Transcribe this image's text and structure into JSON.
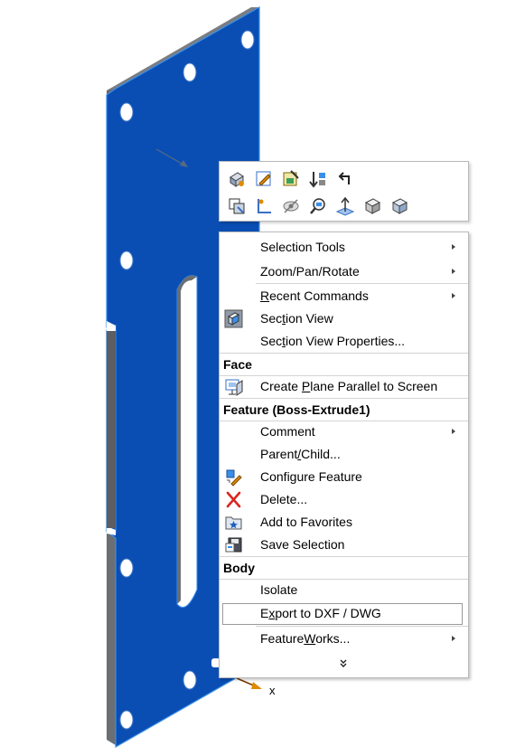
{
  "model": {
    "description_colors": {
      "face": "#0a4eb4",
      "edge": "#6f7277",
      "highlight": "#3a8fe8"
    }
  },
  "axis": {
    "x_label": "x"
  },
  "minitoolbar": {
    "row1_icons": [
      "appearance-icon",
      "edit-sketch-icon",
      "edit-feature-icon",
      "reorder-icon",
      "parent-child-back-icon"
    ],
    "row2_icons": [
      "hide-show-icon",
      "sketch-icon",
      "hide-icon",
      "zoom-to-selection-icon",
      "normal-to-icon",
      "view-orientation-icon",
      "display-style-icon"
    ]
  },
  "menu": {
    "selection_tools": "Selection Tools",
    "zoom_pan_rotate": "Zoom/Pan/Rotate",
    "recent_pre": "",
    "recent_ul": "R",
    "recent_post": "ecent Commands",
    "section_pre": "Sec",
    "section_ul": "t",
    "section_post": "ion View",
    "section_props_pre": "Sec",
    "section_props_ul": "t",
    "section_props_post": "ion View Properties...",
    "face_header": "Face",
    "create_plane_pre": "Create ",
    "create_plane_ul": "P",
    "create_plane_post": "lane Parallel to Screen",
    "feature_header": "Feature (Boss-Extrude1)",
    "comment": "Comment",
    "parent_pre": "Parent",
    "parent_ul": "/",
    "parent_post": "Child...",
    "configure_feature": "Configure Feature",
    "delete": "Delete...",
    "add_favorites": "Add to Favorites",
    "save_selection": "Save Selection",
    "body_header": "Body",
    "isolate": "Isolate",
    "export_pre": "E",
    "export_ul": "x",
    "export_post": "port to DXF / DWG",
    "featureworks_pre": "Feature",
    "featureworks_ul": "W",
    "featureworks_post": "orks...",
    "more_icon": "double-chevron-down-icon"
  }
}
